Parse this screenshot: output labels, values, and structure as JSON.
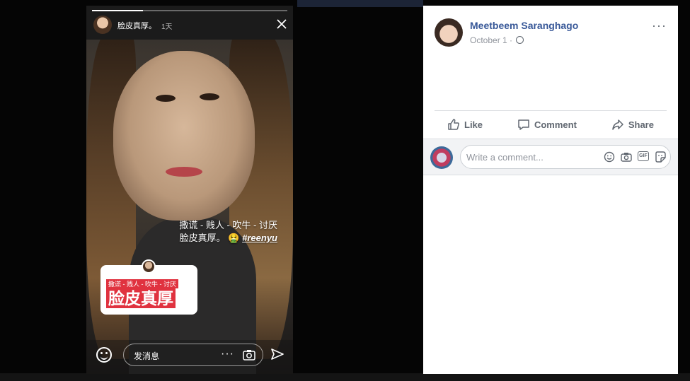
{
  "story": {
    "user_name": "脸皮真厚。",
    "time_ago": "1天",
    "progress": 0.26,
    "caption_line1": "撒谎 - 贱人 - 吹牛 - 讨厌",
    "caption_line2": "脸皮真厚。",
    "caption_emoji": "🤮",
    "caption_hashtag": "#reenyu",
    "sticker_small": "撒谎 - 贱人 - 吹牛 - 讨厌",
    "sticker_big": "脸皮真厚",
    "message_placeholder": "发消息",
    "more_label": "···"
  },
  "post": {
    "author_name": "Meetbeem Saranghago",
    "date": "October 1 ·",
    "privacy_icon": "globe-icon",
    "more_label": "···",
    "actions": [
      {
        "label": "Like",
        "icon": "thumbs-up-icon"
      },
      {
        "label": "Comment",
        "icon": "comment-icon"
      },
      {
        "label": "Share",
        "icon": "share-icon"
      }
    ],
    "comment_placeholder": "Write a comment...",
    "comment_icons": [
      "emoji-icon",
      "camera-icon",
      "gif-icon",
      "sticker-icon"
    ],
    "gif_label": "GIF"
  },
  "colors": {
    "link_blue": "#385898",
    "muted_gray": "#606770",
    "accent_red": "#e0323f"
  }
}
